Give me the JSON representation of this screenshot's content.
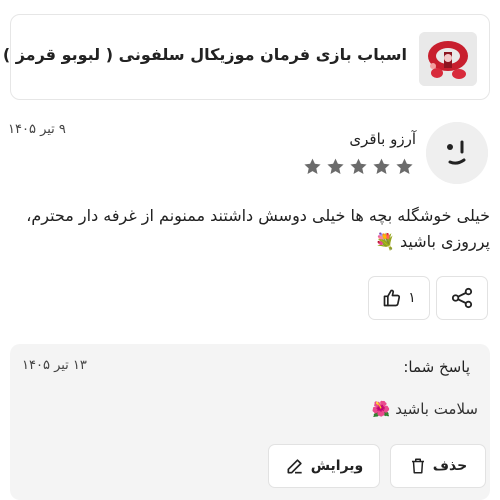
{
  "product": {
    "title": "اسباب بازی فرمان موزیکال سلفونی ( لبوبو قرمز )",
    "thumbnail_icon": "red-steering-wheel-toy-icon"
  },
  "review": {
    "author": "آرزو باقری",
    "date": "۹ تیر ۱۴۰۵",
    "rating": 5,
    "rating_max": 5,
    "star_color": "#6b6b6b",
    "avatar_icon": "smiley-face-icon",
    "text": "خیلی خوشگله بچه ها خیلی دوسش داشتند ممنونم از غرفه دار محترم، پرروزی باشید 💐"
  },
  "actions": {
    "like_count": "۱",
    "like_icon": "thumbs-up-icon",
    "share_icon": "share-icon"
  },
  "reply": {
    "title": "پاسخ شما:",
    "date": "۱۳ تیر ۱۴۰۵",
    "text": "سلامت باشید 🌺",
    "delete_label": "حذف",
    "edit_label": "ویرایش",
    "delete_icon": "trash-icon",
    "edit_icon": "edit-icon",
    "background": "#f4f4f4"
  }
}
